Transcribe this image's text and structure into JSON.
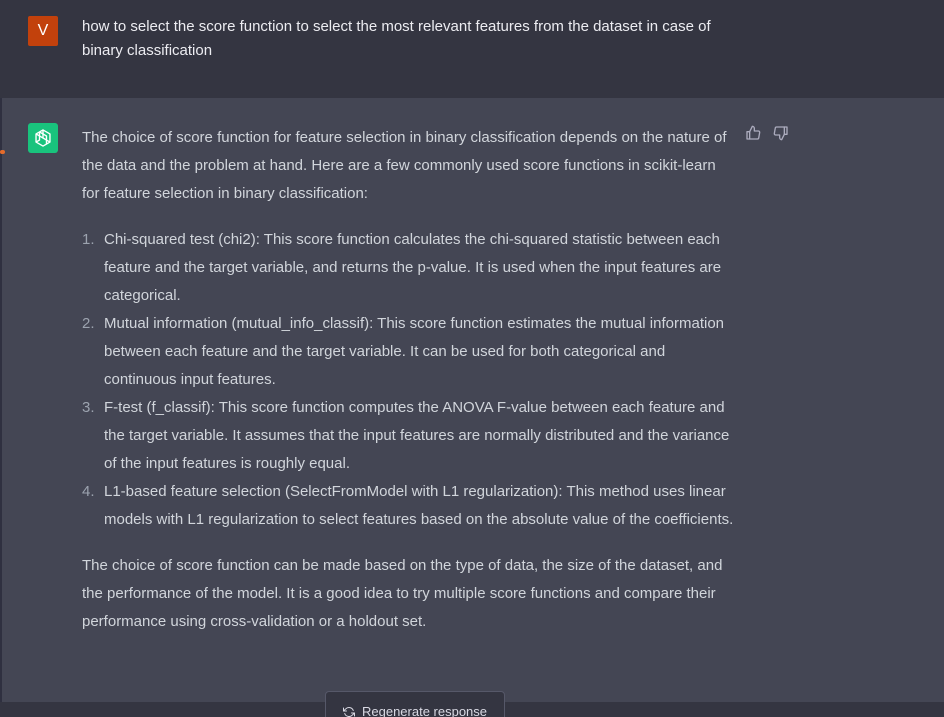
{
  "user_message": {
    "avatar_letter": "V",
    "text": "how to select the score function to select the most relevant features from the dataset in case of binary classification"
  },
  "assistant_message": {
    "intro": "The choice of score function for feature selection in binary classification depends on the nature of the data and the problem at hand. Here are a few commonly used score functions in scikit-learn for feature selection in binary classification:",
    "items": [
      {
        "number": "1.",
        "text": "Chi-squared test (chi2): This score function calculates the chi-squared statistic between each feature and the target variable, and returns the p-value. It is used when the input features are categorical."
      },
      {
        "number": "2.",
        "text": "Mutual information (mutual_info_classif): This score function estimates the mutual information between each feature and the target variable. It can be used for both categorical and continuous input features."
      },
      {
        "number": "3.",
        "text": "F-test (f_classif): This score function computes the ANOVA F-value between each feature and the target variable. It assumes that the input features are normally distributed and the variance of the input features is roughly equal."
      },
      {
        "number": "4.",
        "text": "L1-based feature selection (SelectFromModel with L1 regularization): This method uses linear models with L1 regularization to select features based on the absolute value of the coefficients."
      }
    ],
    "conclusion": "The choice of score function can be made based on the type of data, the size of the dataset, and the performance of the model. It is a good idea to try multiple score functions and compare their performance using cross-validation or a holdout set."
  },
  "actions": {
    "regenerate_label": "Regenerate response",
    "thumbs_up_icon": "thumbs-up-icon",
    "thumbs_down_icon": "thumbs-down-icon"
  },
  "colors": {
    "background": "#343541",
    "assistant_background": "#444654",
    "user_avatar": "#c2410c",
    "bot_avatar": "#19c37d"
  }
}
